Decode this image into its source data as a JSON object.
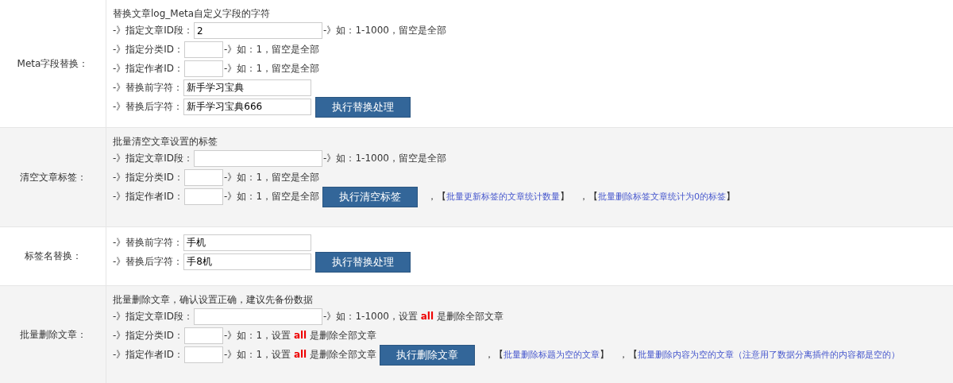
{
  "sections": [
    {
      "label": "Meta字段替换：",
      "title": "替换文章log_Meta自定义字段的字符",
      "fields": [
        {
          "kind": "range",
          "label": "-》指定文章ID段：",
          "value": "2",
          "hint": "-》如：1-1000，留空是全部"
        },
        {
          "kind": "id",
          "label": "-》指定分类ID：",
          "hint": "-》如：1，留空是全部"
        },
        {
          "kind": "id",
          "label": "-》指定作者ID：",
          "hint": "-》如：1，留空是全部"
        },
        {
          "kind": "text",
          "label": "-》替换前字符：",
          "value": "新手学习宝典"
        },
        {
          "kind": "text",
          "label": "-》替换后字符：",
          "value": "新手学习宝典666",
          "button": "执行替换处理"
        }
      ]
    },
    {
      "label": "清空文章标签：",
      "title": "批量清空文章设置的标签",
      "fields": [
        {
          "kind": "range",
          "label": "-》指定文章ID段：",
          "hint": "-》如：1-1000，留空是全部"
        },
        {
          "kind": "id",
          "label": "-》指定分类ID：",
          "hint": "-》如：1，留空是全部"
        },
        {
          "kind": "id",
          "label": "-》指定作者ID：",
          "hint": "-》如：1，留空是全部",
          "button": "执行清空标签",
          "links": [
            {
              "prefix": "，【",
              "text": "批量更新标签的文章统计数量",
              "suffix": "】"
            },
            {
              "prefix": "，【",
              "text": "批量删除标签文章统计为0的标签",
              "suffix": "】"
            }
          ]
        }
      ]
    },
    {
      "label": "标签名替换：",
      "fields": [
        {
          "kind": "text",
          "label": "-》替换前字符：",
          "value": "手机"
        },
        {
          "kind": "text",
          "label": "-》替换后字符：",
          "value": "手8机",
          "button": "执行替换处理"
        }
      ]
    },
    {
      "label": "批量删除文章：",
      "title": "批量删除文章，确认设置正确，建议先备份数据",
      "fields": [
        {
          "kind": "range",
          "label": "-》指定文章ID段：",
          "hint": "-》如：1-1000，设置 **all** 是删除全部文章"
        },
        {
          "kind": "id",
          "label": "-》指定分类ID：",
          "hint": "-》如：1，设置 **all** 是删除全部文章"
        },
        {
          "kind": "id",
          "label": "-》指定作者ID：",
          "hint": "-》如：1，设置 **all** 是删除全部文章",
          "button": "执行删除文章",
          "links": [
            {
              "prefix": "，【",
              "text": "批量删除标题为空的文章",
              "suffix": "】"
            },
            {
              "prefix": "，【",
              "text": "批量删除内容为空的文章（注意用了数据分离插件的内容都是空的）"
            }
          ]
        }
      ]
    }
  ]
}
